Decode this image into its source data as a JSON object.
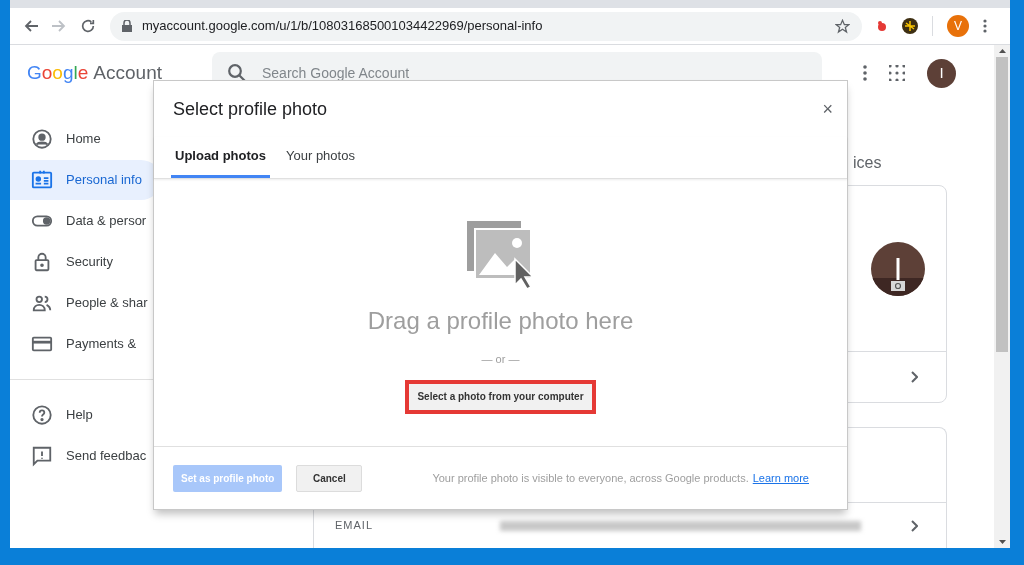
{
  "browser": {
    "url": "myaccount.google.com/u/1/b/108031685001034422969/personal-info",
    "profile_initial": "V"
  },
  "header": {
    "logo_google": "Google",
    "logo_account": "Account",
    "search_placeholder": "Search Google Account",
    "avatar_initial": "I"
  },
  "sidebar": {
    "items": [
      {
        "label": "Home",
        "selected": false
      },
      {
        "label": "Personal info",
        "selected": true
      },
      {
        "label": "Data & persor",
        "selected": false
      },
      {
        "label": "Security",
        "selected": false
      },
      {
        "label": "People & shar",
        "selected": false
      },
      {
        "label": "Payments &",
        "selected": false
      }
    ],
    "footer_items": [
      {
        "label": "Help",
        "selected": false
      },
      {
        "label": "Send feedbac",
        "selected": false
      }
    ]
  },
  "page": {
    "heading_fragment": "ices",
    "email_label": "EMAIL"
  },
  "dialog": {
    "title": "Select profile photo",
    "close": "×",
    "tabs": [
      {
        "label": "Upload photos",
        "selected": true
      },
      {
        "label": "Your photos",
        "selected": false
      }
    ],
    "drop_text": "Drag a profile photo here",
    "or_text": "— or —",
    "select_button": {
      "label": "Select a photo from your computer",
      "highlighted": true
    },
    "primary_button": {
      "label": "Set as profile photo",
      "disabled": true
    },
    "cancel_button": {
      "label": "Cancel"
    },
    "notice": "Your profile photo is visible to everyone, across Google products.",
    "link": "Learn more"
  }
}
